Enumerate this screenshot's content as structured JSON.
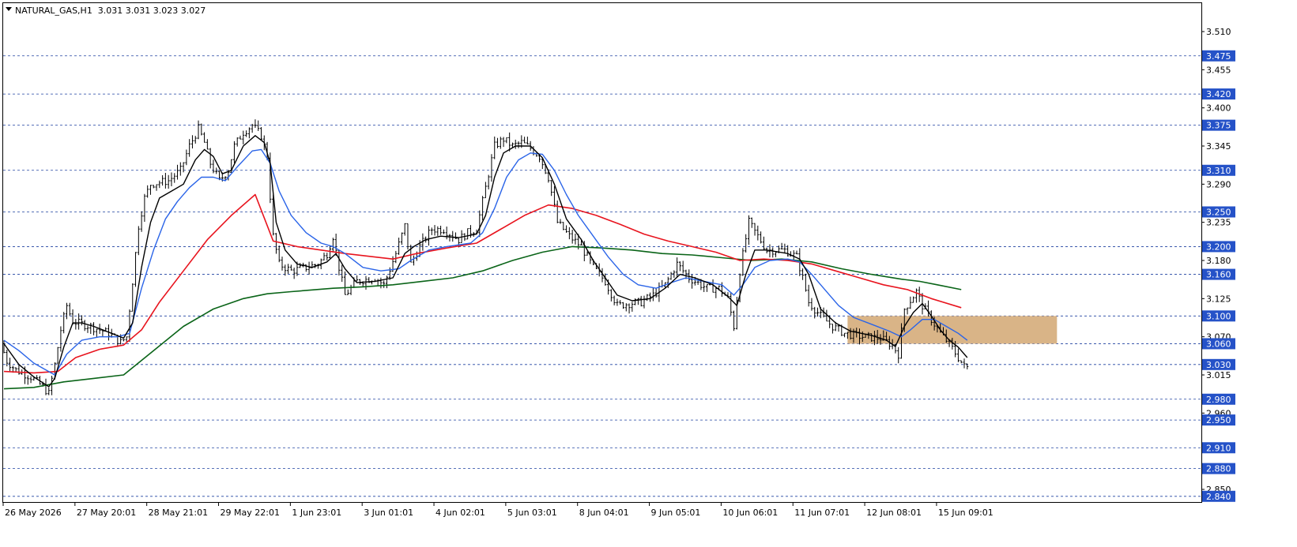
{
  "header": {
    "label": "NATURAL_GAS,H1  3.031 3.031 3.023 3.027"
  },
  "colors": {
    "background": "#ffffff",
    "grid": "#1e40a0",
    "ohlc": "#000000",
    "ma_black": "#000000",
    "ma_blue": "#2a64e8",
    "ma_red": "#e8141e",
    "ma_green": "#0a6418",
    "zone_fill": "#d9b487",
    "level_label_bg": "#2552c8",
    "level_label_text": "#ffffff"
  },
  "chart_data": {
    "type": "candlestick",
    "symbol": "NATURAL_GAS",
    "timeframe": "H1",
    "last_bar": {
      "open": 3.031,
      "high": 3.031,
      "low": 3.023,
      "close": 3.027
    },
    "ylim": [
      2.83,
      3.53
    ],
    "axis_ticks": [
      3.51,
      3.455,
      3.4,
      3.345,
      3.29,
      3.235,
      3.18,
      3.125,
      3.07,
      3.015,
      2.96,
      2.85
    ],
    "levels": [
      3.475,
      3.42,
      3.375,
      3.31,
      3.25,
      3.2,
      3.16,
      3.1,
      3.06,
      3.03,
      2.98,
      2.95,
      2.91,
      2.88,
      2.84
    ],
    "level_labels": [
      "3.475",
      "3.420",
      "3.375",
      "3.310",
      "3.250",
      "3.200",
      "3.160",
      "3.100",
      "3.060",
      "3.030",
      "2.980",
      "2.950",
      "2.910",
      "2.880",
      "2.840"
    ],
    "x_labels": [
      "26 May 2026",
      "27 May 20:01",
      "28 May 21:01",
      "29 May 22:01",
      "1 Jun 23:01",
      "3 Jun 01:01",
      "4 Jun 02:01",
      "5 Jun 03:01",
      "8 Jun 04:01",
      "9 Jun 05:01",
      "10 Jun 06:01",
      "11 Jun 07:01",
      "12 Jun 08:01",
      "15 Jun 09:01"
    ],
    "bars_per_label": 24,
    "zone": {
      "from_bar": 282,
      "to_bar": 352,
      "low": 3.06,
      "high": 3.1
    },
    "price_path": [
      [
        0,
        3.06
      ],
      [
        2,
        3.035
      ],
      [
        5,
        3.022
      ],
      [
        10,
        3.012
      ],
      [
        14,
        2.998
      ],
      [
        16,
        2.988
      ],
      [
        18,
        3.03
      ],
      [
        20,
        3.08
      ],
      [
        22,
        3.115
      ],
      [
        24,
        3.092
      ],
      [
        30,
        3.085
      ],
      [
        36,
        3.075
      ],
      [
        40,
        3.062
      ],
      [
        42,
        3.07
      ],
      [
        44,
        3.15
      ],
      [
        46,
        3.23
      ],
      [
        48,
        3.27
      ],
      [
        50,
        3.29
      ],
      [
        56,
        3.295
      ],
      [
        60,
        3.31
      ],
      [
        63,
        3.345
      ],
      [
        66,
        3.37
      ],
      [
        68,
        3.35
      ],
      [
        70,
        3.32
      ],
      [
        73,
        3.295
      ],
      [
        76,
        3.31
      ],
      [
        78,
        3.345
      ],
      [
        81,
        3.365
      ],
      [
        84,
        3.375
      ],
      [
        87,
        3.36
      ],
      [
        89,
        3.33
      ],
      [
        91,
        3.215
      ],
      [
        93,
        3.175
      ],
      [
        97,
        3.165
      ],
      [
        102,
        3.17
      ],
      [
        106,
        3.175
      ],
      [
        109,
        3.19
      ],
      [
        111,
        3.215
      ],
      [
        113,
        3.17
      ],
      [
        115,
        3.13
      ],
      [
        119,
        3.15
      ],
      [
        125,
        3.155
      ],
      [
        128,
        3.145
      ],
      [
        132,
        3.19
      ],
      [
        135,
        3.23
      ],
      [
        137,
        3.175
      ],
      [
        140,
        3.2
      ],
      [
        144,
        3.225
      ],
      [
        148,
        3.225
      ],
      [
        153,
        3.21
      ],
      [
        156,
        3.22
      ],
      [
        159,
        3.225
      ],
      [
        162,
        3.285
      ],
      [
        165,
        3.345
      ],
      [
        168,
        3.355
      ],
      [
        171,
        3.345
      ],
      [
        174,
        3.35
      ],
      [
        177,
        3.342
      ],
      [
        180,
        3.33
      ],
      [
        183,
        3.3
      ],
      [
        186,
        3.235
      ],
      [
        190,
        3.215
      ],
      [
        194,
        3.2
      ],
      [
        198,
        3.17
      ],
      [
        202,
        3.15
      ],
      [
        206,
        3.115
      ],
      [
        210,
        3.118
      ],
      [
        214,
        3.12
      ],
      [
        218,
        3.13
      ],
      [
        222,
        3.145
      ],
      [
        226,
        3.175
      ],
      [
        230,
        3.155
      ],
      [
        236,
        3.14
      ],
      [
        240,
        3.14
      ],
      [
        243,
        3.125
      ],
      [
        245,
        3.085
      ],
      [
        247,
        3.165
      ],
      [
        250,
        3.235
      ],
      [
        253,
        3.215
      ],
      [
        256,
        3.195
      ],
      [
        262,
        3.195
      ],
      [
        266,
        3.185
      ],
      [
        268,
        3.155
      ],
      [
        270,
        3.12
      ],
      [
        274,
        3.1
      ],
      [
        278,
        3.085
      ],
      [
        282,
        3.075
      ],
      [
        288,
        3.07
      ],
      [
        294,
        3.068
      ],
      [
        298,
        3.058
      ],
      [
        300,
        3.045
      ],
      [
        302,
        3.11
      ],
      [
        306,
        3.135
      ],
      [
        308,
        3.115
      ],
      [
        311,
        3.095
      ],
      [
        314,
        3.075
      ],
      [
        317,
        3.06
      ],
      [
        320,
        3.04
      ],
      [
        322,
        3.027
      ]
    ],
    "ma_black_points": [
      [
        0,
        3.06
      ],
      [
        5,
        3.03
      ],
      [
        10,
        3.012
      ],
      [
        15,
        2.998
      ],
      [
        17,
        3.01
      ],
      [
        20,
        3.055
      ],
      [
        23,
        3.09
      ],
      [
        26,
        3.09
      ],
      [
        30,
        3.085
      ],
      [
        36,
        3.075
      ],
      [
        40,
        3.068
      ],
      [
        43,
        3.09
      ],
      [
        46,
        3.17
      ],
      [
        49,
        3.235
      ],
      [
        52,
        3.27
      ],
      [
        56,
        3.28
      ],
      [
        60,
        3.29
      ],
      [
        64,
        3.325
      ],
      [
        67,
        3.34
      ],
      [
        70,
        3.33
      ],
      [
        73,
        3.305
      ],
      [
        76,
        3.31
      ],
      [
        80,
        3.345
      ],
      [
        84,
        3.36
      ],
      [
        87,
        3.35
      ],
      [
        89,
        3.32
      ],
      [
        91,
        3.235
      ],
      [
        94,
        3.195
      ],
      [
        98,
        3.175
      ],
      [
        103,
        3.17
      ],
      [
        108,
        3.178
      ],
      [
        111,
        3.19
      ],
      [
        114,
        3.168
      ],
      [
        118,
        3.148
      ],
      [
        124,
        3.15
      ],
      [
        130,
        3.155
      ],
      [
        134,
        3.19
      ],
      [
        137,
        3.2
      ],
      [
        141,
        3.21
      ],
      [
        146,
        3.215
      ],
      [
        152,
        3.213
      ],
      [
        158,
        3.218
      ],
      [
        161,
        3.245
      ],
      [
        164,
        3.3
      ],
      [
        167,
        3.335
      ],
      [
        171,
        3.345
      ],
      [
        176,
        3.345
      ],
      [
        180,
        3.328
      ],
      [
        184,
        3.29
      ],
      [
        188,
        3.24
      ],
      [
        193,
        3.21
      ],
      [
        197,
        3.18
      ],
      [
        201,
        3.155
      ],
      [
        205,
        3.13
      ],
      [
        210,
        3.122
      ],
      [
        216,
        3.125
      ],
      [
        221,
        3.14
      ],
      [
        226,
        3.16
      ],
      [
        231,
        3.155
      ],
      [
        237,
        3.145
      ],
      [
        242,
        3.128
      ],
      [
        245,
        3.115
      ],
      [
        248,
        3.16
      ],
      [
        251,
        3.195
      ],
      [
        255,
        3.195
      ],
      [
        262,
        3.19
      ],
      [
        266,
        3.182
      ],
      [
        269,
        3.16
      ],
      [
        273,
        3.11
      ],
      [
        278,
        3.09
      ],
      [
        283,
        3.078
      ],
      [
        290,
        3.072
      ],
      [
        295,
        3.065
      ],
      [
        298,
        3.056
      ],
      [
        301,
        3.085
      ],
      [
        304,
        3.105
      ],
      [
        307,
        3.118
      ],
      [
        310,
        3.1
      ],
      [
        313,
        3.08
      ],
      [
        316,
        3.065
      ],
      [
        319,
        3.055
      ],
      [
        322,
        3.04
      ]
    ],
    "ma_blue_points": [
      [
        0,
        3.065
      ],
      [
        5,
        3.05
      ],
      [
        10,
        3.032
      ],
      [
        17,
        3.015
      ],
      [
        21,
        3.045
      ],
      [
        26,
        3.065
      ],
      [
        32,
        3.07
      ],
      [
        38,
        3.07
      ],
      [
        42,
        3.075
      ],
      [
        46,
        3.14
      ],
      [
        50,
        3.195
      ],
      [
        54,
        3.24
      ],
      [
        58,
        3.265
      ],
      [
        62,
        3.285
      ],
      [
        66,
        3.3
      ],
      [
        70,
        3.3
      ],
      [
        74,
        3.295
      ],
      [
        78,
        3.315
      ],
      [
        83,
        3.338
      ],
      [
        86,
        3.34
      ],
      [
        89,
        3.32
      ],
      [
        92,
        3.28
      ],
      [
        96,
        3.245
      ],
      [
        101,
        3.22
      ],
      [
        106,
        3.205
      ],
      [
        110,
        3.2
      ],
      [
        114,
        3.19
      ],
      [
        120,
        3.17
      ],
      [
        126,
        3.165
      ],
      [
        132,
        3.168
      ],
      [
        136,
        3.18
      ],
      [
        142,
        3.195
      ],
      [
        148,
        3.2
      ],
      [
        156,
        3.205
      ],
      [
        160,
        3.22
      ],
      [
        164,
        3.255
      ],
      [
        168,
        3.3
      ],
      [
        172,
        3.325
      ],
      [
        176,
        3.335
      ],
      [
        180,
        3.333
      ],
      [
        184,
        3.31
      ],
      [
        188,
        3.275
      ],
      [
        192,
        3.245
      ],
      [
        197,
        3.215
      ],
      [
        202,
        3.185
      ],
      [
        207,
        3.16
      ],
      [
        212,
        3.145
      ],
      [
        218,
        3.14
      ],
      [
        223,
        3.148
      ],
      [
        228,
        3.155
      ],
      [
        234,
        3.15
      ],
      [
        240,
        3.145
      ],
      [
        244,
        3.13
      ],
      [
        247,
        3.145
      ],
      [
        251,
        3.17
      ],
      [
        256,
        3.18
      ],
      [
        262,
        3.182
      ],
      [
        266,
        3.178
      ],
      [
        270,
        3.16
      ],
      [
        274,
        3.14
      ],
      [
        279,
        3.115
      ],
      [
        284,
        3.098
      ],
      [
        290,
        3.088
      ],
      [
        296,
        3.078
      ],
      [
        300,
        3.07
      ],
      [
        303,
        3.08
      ],
      [
        307,
        3.095
      ],
      [
        311,
        3.095
      ],
      [
        315,
        3.085
      ],
      [
        319,
        3.075
      ],
      [
        322,
        3.065
      ]
    ],
    "ma_red_points": [
      [
        0,
        3.02
      ],
      [
        10,
        3.018
      ],
      [
        18,
        3.02
      ],
      [
        24,
        3.04
      ],
      [
        32,
        3.052
      ],
      [
        40,
        3.058
      ],
      [
        46,
        3.08
      ],
      [
        52,
        3.12
      ],
      [
        60,
        3.165
      ],
      [
        68,
        3.21
      ],
      [
        76,
        3.245
      ],
      [
        84,
        3.275
      ],
      [
        90,
        3.208
      ],
      [
        98,
        3.2
      ],
      [
        106,
        3.195
      ],
      [
        114,
        3.19
      ],
      [
        124,
        3.185
      ],
      [
        130,
        3.182
      ],
      [
        138,
        3.19
      ],
      [
        148,
        3.198
      ],
      [
        158,
        3.205
      ],
      [
        166,
        3.225
      ],
      [
        174,
        3.245
      ],
      [
        182,
        3.26
      ],
      [
        190,
        3.255
      ],
      [
        198,
        3.245
      ],
      [
        206,
        3.232
      ],
      [
        214,
        3.218
      ],
      [
        222,
        3.208
      ],
      [
        230,
        3.2
      ],
      [
        238,
        3.192
      ],
      [
        246,
        3.18
      ],
      [
        254,
        3.182
      ],
      [
        262,
        3.18
      ],
      [
        270,
        3.175
      ],
      [
        278,
        3.165
      ],
      [
        286,
        3.155
      ],
      [
        294,
        3.145
      ],
      [
        302,
        3.138
      ],
      [
        310,
        3.125
      ],
      [
        320,
        3.112
      ]
    ],
    "ma_green_points": [
      [
        0,
        2.995
      ],
      [
        10,
        2.997
      ],
      [
        20,
        3.005
      ],
      [
        30,
        3.01
      ],
      [
        40,
        3.015
      ],
      [
        50,
        3.05
      ],
      [
        60,
        3.085
      ],
      [
        70,
        3.11
      ],
      [
        80,
        3.125
      ],
      [
        88,
        3.132
      ],
      [
        96,
        3.135
      ],
      [
        110,
        3.14
      ],
      [
        120,
        3.142
      ],
      [
        130,
        3.145
      ],
      [
        140,
        3.15
      ],
      [
        150,
        3.155
      ],
      [
        160,
        3.165
      ],
      [
        170,
        3.18
      ],
      [
        180,
        3.192
      ],
      [
        190,
        3.2
      ],
      [
        200,
        3.198
      ],
      [
        210,
        3.195
      ],
      [
        220,
        3.19
      ],
      [
        230,
        3.188
      ],
      [
        240,
        3.184
      ],
      [
        250,
        3.18
      ],
      [
        260,
        3.182
      ],
      [
        270,
        3.178
      ],
      [
        280,
        3.168
      ],
      [
        290,
        3.16
      ],
      [
        300,
        3.153
      ],
      [
        306,
        3.15
      ],
      [
        312,
        3.145
      ],
      [
        320,
        3.138
      ]
    ]
  }
}
